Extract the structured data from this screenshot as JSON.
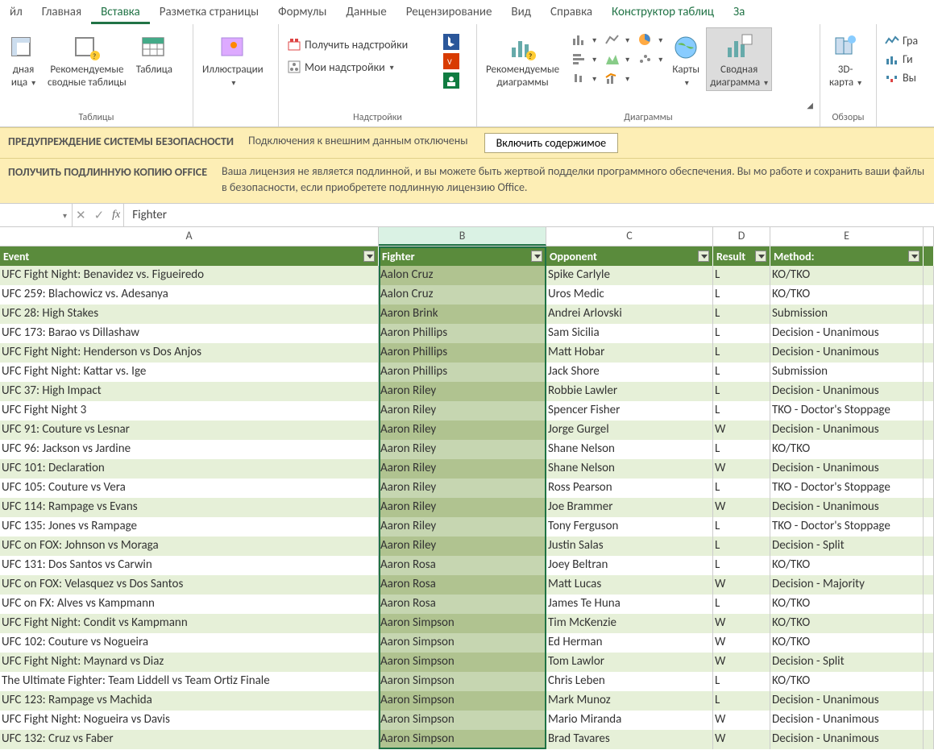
{
  "tabs": {
    "file": "йл",
    "main": "Главная",
    "insert": "Вставка",
    "layout": "Разметка страницы",
    "formulas": "Формулы",
    "data": "Данные",
    "review": "Рецензирование",
    "view": "Вид",
    "help": "Справка",
    "tabledesign": "Конструктор таблиц",
    "extra": "За"
  },
  "ribbon": {
    "group_tables": "Таблицы",
    "pivot1a": "дная",
    "pivot1b": "ица",
    "recpivot1": "Рекомендуемые",
    "recpivot2": "сводные таблицы",
    "table": "Таблица",
    "illus": "Иллюстрации",
    "group_addins": "Надстройки",
    "getaddins": "Получить надстройки",
    "myaddins": "Мои надстройки",
    "group_charts": "Диаграммы",
    "reccharts1": "Рекомендуемые",
    "reccharts2": "диаграммы",
    "maps": "Карты",
    "pivotchart1": "Сводная",
    "pivotchart2": "диаграмма",
    "group_tours": "Обзоры",
    "map3d1": "3D-",
    "map3d2": "карта",
    "spark_line": "Гра",
    "spark_col": "Ги",
    "spark_win": "Вы"
  },
  "warn1": {
    "title": "ПРЕДУПРЕЖДЕНИЕ СИСТЕМЫ БЕЗОПАСНОСТИ",
    "text": "Подключения к внешним данным отключены",
    "btn": "Включить содержимое"
  },
  "warn2": {
    "title": "ПОЛУЧИТЬ ПОДЛИННУЮ КОПИЮ OFFICE",
    "text": "Ваша лицензия не является подлинной, и вы можете быть жертвой подделки программного обеспечения. Вы мо работе и сохранить ваши файлы в безопасности, если приобретете подлинную лицензию Office."
  },
  "formula_bar": {
    "fx": "fx",
    "value": "Fighter"
  },
  "cols": {
    "a": "A",
    "b": "B",
    "c": "C",
    "d": "D",
    "e": "E"
  },
  "headers": {
    "event": "Event",
    "fighter": "Fighter",
    "opponent": "Opponent",
    "result": "Result",
    "method": "Method:"
  },
  "rows": [
    {
      "event": "UFC Fight Night: Benavidez vs. Figueiredo",
      "fighter": "Aalon Cruz",
      "opponent": "Spike Carlyle",
      "result": "L",
      "method": "KO/TKO"
    },
    {
      "event": "UFC 259: Blachowicz vs. Adesanya",
      "fighter": "Aalon Cruz",
      "opponent": "Uros Medic",
      "result": "L",
      "method": "KO/TKO"
    },
    {
      "event": "UFC 28: High Stakes",
      "fighter": "Aaron Brink",
      "opponent": "Andrei Arlovski",
      "result": "L",
      "method": "Submission"
    },
    {
      "event": "UFC 173: Barao vs Dillashaw",
      "fighter": "Aaron Phillips",
      "opponent": "Sam Sicilia",
      "result": "L",
      "method": "Decision - Unanimous"
    },
    {
      "event": "UFC Fight Night: Henderson vs Dos Anjos",
      "fighter": "Aaron Phillips",
      "opponent": "Matt Hobar",
      "result": "L",
      "method": "Decision - Unanimous"
    },
    {
      "event": "UFC Fight Night: Kattar vs. Ige",
      "fighter": "Aaron Phillips",
      "opponent": "Jack Shore",
      "result": "L",
      "method": "Submission"
    },
    {
      "event": "UFC 37: High Impact",
      "fighter": "Aaron Riley",
      "opponent": "Robbie Lawler",
      "result": "L",
      "method": "Decision - Unanimous"
    },
    {
      "event": "UFC Fight Night 3",
      "fighter": "Aaron Riley",
      "opponent": "Spencer Fisher",
      "result": "L",
      "method": "TKO - Doctor's Stoppage"
    },
    {
      "event": "UFC 91: Couture vs Lesnar",
      "fighter": "Aaron Riley",
      "opponent": "Jorge Gurgel",
      "result": "W",
      "method": "Decision - Unanimous"
    },
    {
      "event": "UFC 96: Jackson vs Jardine",
      "fighter": "Aaron Riley",
      "opponent": "Shane Nelson",
      "result": "L",
      "method": "KO/TKO"
    },
    {
      "event": "UFC 101: Declaration",
      "fighter": "Aaron Riley",
      "opponent": "Shane Nelson",
      "result": "W",
      "method": "Decision - Unanimous"
    },
    {
      "event": "UFC 105: Couture vs Vera",
      "fighter": "Aaron Riley",
      "opponent": "Ross Pearson",
      "result": "L",
      "method": "TKO - Doctor's Stoppage"
    },
    {
      "event": "UFC 114: Rampage vs Evans",
      "fighter": "Aaron Riley",
      "opponent": "Joe Brammer",
      "result": "W",
      "method": "Decision - Unanimous"
    },
    {
      "event": "UFC 135: Jones vs Rampage",
      "fighter": "Aaron Riley",
      "opponent": "Tony Ferguson",
      "result": "L",
      "method": "TKO - Doctor's Stoppage"
    },
    {
      "event": "UFC on FOX: Johnson vs Moraga",
      "fighter": "Aaron Riley",
      "opponent": "Justin Salas",
      "result": "L",
      "method": "Decision - Split"
    },
    {
      "event": "UFC 131: Dos Santos vs Carwin",
      "fighter": "Aaron Rosa",
      "opponent": "Joey Beltran",
      "result": "L",
      "method": "KO/TKO"
    },
    {
      "event": "UFC on FOX: Velasquez vs Dos Santos",
      "fighter": "Aaron Rosa",
      "opponent": "Matt Lucas",
      "result": "W",
      "method": "Decision - Majority"
    },
    {
      "event": "UFC on FX: Alves vs Kampmann",
      "fighter": "Aaron Rosa",
      "opponent": "James Te Huna",
      "result": "L",
      "method": "KO/TKO"
    },
    {
      "event": "UFC Fight Night: Condit vs Kampmann",
      "fighter": "Aaron Simpson",
      "opponent": "Tim McKenzie",
      "result": "W",
      "method": "KO/TKO"
    },
    {
      "event": "UFC 102: Couture vs Nogueira",
      "fighter": "Aaron Simpson",
      "opponent": "Ed Herman",
      "result": "W",
      "method": "KO/TKO"
    },
    {
      "event": "UFC Fight Night: Maynard vs Diaz",
      "fighter": "Aaron Simpson",
      "opponent": "Tom Lawlor",
      "result": "W",
      "method": "Decision - Split"
    },
    {
      "event": "The Ultimate Fighter: Team Liddell vs Team Ortiz Finale",
      "fighter": "Aaron Simpson",
      "opponent": "Chris Leben",
      "result": "L",
      "method": "KO/TKO"
    },
    {
      "event": "UFC 123: Rampage vs Machida",
      "fighter": "Aaron Simpson",
      "opponent": "Mark Munoz",
      "result": "L",
      "method": "Decision - Unanimous"
    },
    {
      "event": "UFC Fight Night: Nogueira vs Davis",
      "fighter": "Aaron Simpson",
      "opponent": "Mario Miranda",
      "result": "W",
      "method": "Decision - Unanimous"
    },
    {
      "event": "UFC 132: Cruz vs Faber",
      "fighter": "Aaron Simpson",
      "opponent": "Brad Tavares",
      "result": "W",
      "method": "Decision - Unanimous"
    }
  ]
}
